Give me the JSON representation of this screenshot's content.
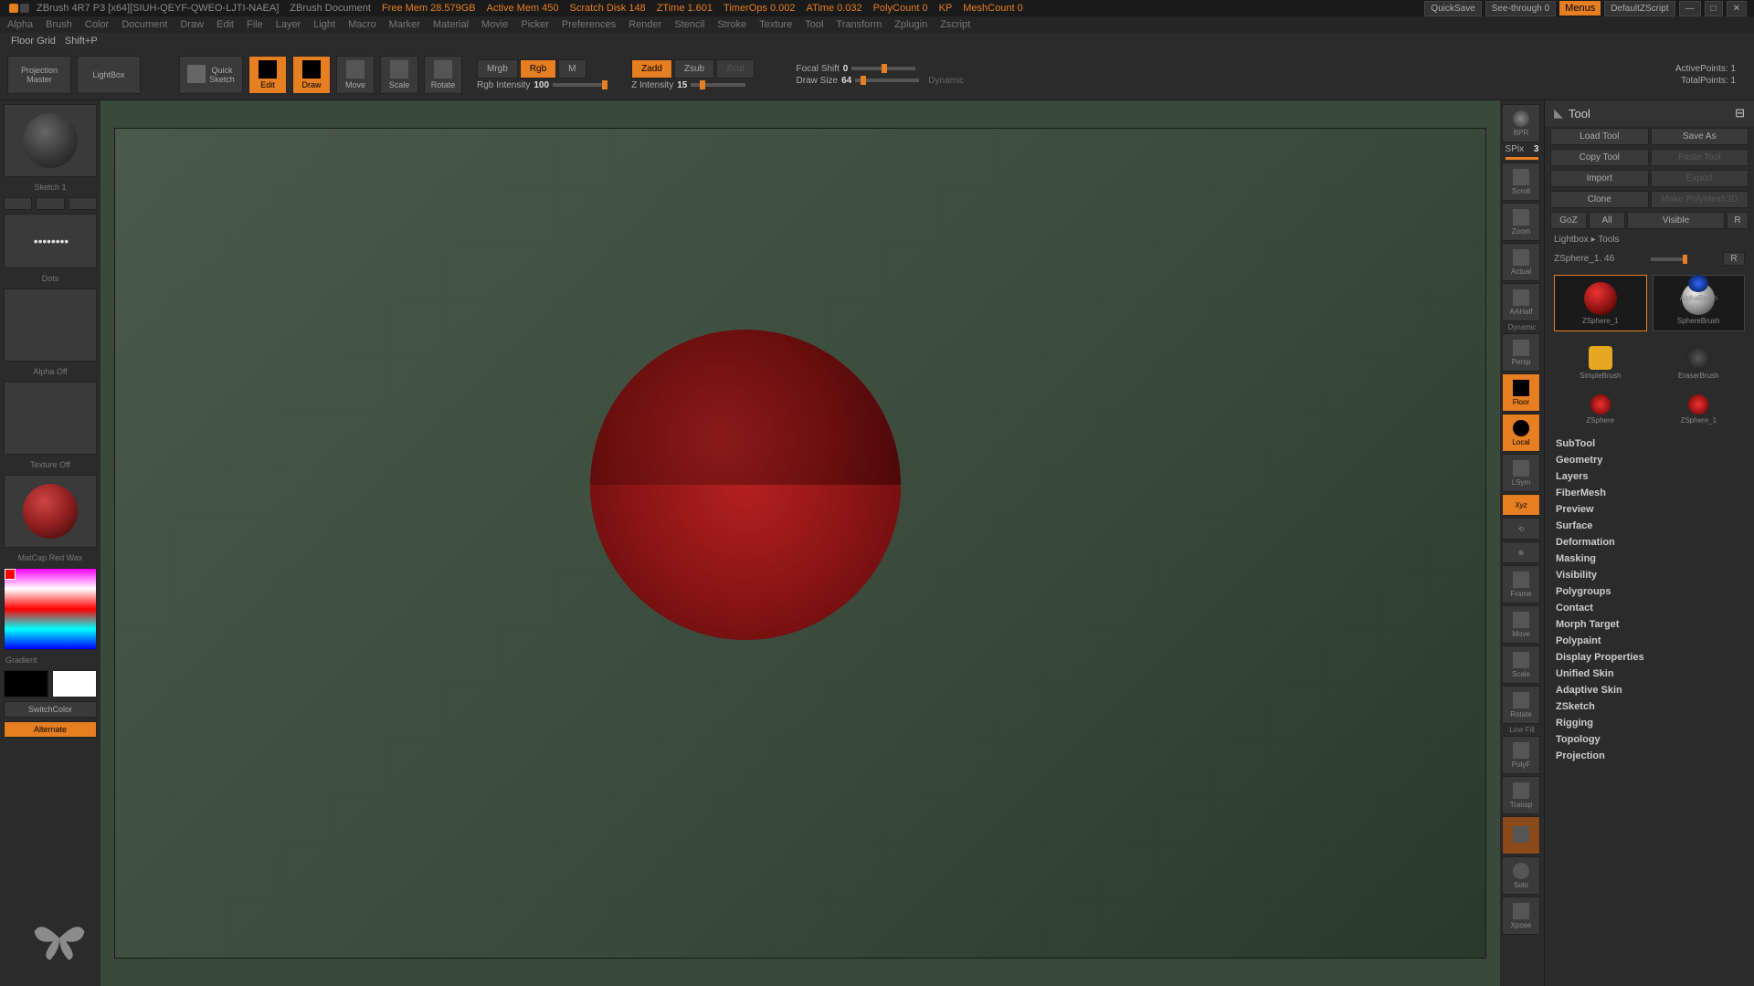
{
  "title": {
    "app": "ZBrush 4R7 P3 [x64][SIUH-QEYF-QWEO-LJTI-NAEA]",
    "doc": "ZBrush Document",
    "stats": [
      "Free Mem 28.579GB",
      "Active Mem 450",
      "Scratch Disk 148",
      "ZTime 1.601",
      "TimerOps 0.002",
      "ATime 0.032",
      "PolyCount 0",
      "KP",
      "MeshCount 0"
    ],
    "quicksave": "QuickSave",
    "seethrough": "See-through  0",
    "menus": "Menus",
    "script": "DefaultZScript"
  },
  "menu": [
    "Alpha",
    "Brush",
    "Color",
    "Document",
    "Draw",
    "Edit",
    "File",
    "Layer",
    "Light",
    "Macro",
    "Marker",
    "Material",
    "Movie",
    "Picker",
    "Preferences",
    "Render",
    "Stencil",
    "Stroke",
    "Texture",
    "Tool",
    "Transform",
    "Zplugin",
    "Zscript"
  ],
  "status": {
    "label": "Floor Grid",
    "shortcut": "Shift+P"
  },
  "toolbar": {
    "projection": "Projection\nMaster",
    "lightbox": "LightBox",
    "quicksketch": "Quick\nSketch",
    "edit": "Edit",
    "draw": "Draw",
    "move": "Move",
    "scale": "Scale",
    "rotate": "Rotate",
    "mrgb": "Mrgb",
    "rgb": "Rgb",
    "m": "M",
    "rgb_intensity_label": "Rgb Intensity",
    "rgb_intensity_val": "100",
    "zadd": "Zadd",
    "zsub": "Zsub",
    "zcut": "Zcut",
    "z_intensity_label": "Z Intensity",
    "z_intensity_val": "15",
    "focal_label": "Focal Shift",
    "focal_val": "0",
    "draw_size_label": "Draw Size",
    "draw_size_val": "64",
    "dynamic": "Dynamic",
    "active_pts": "ActivePoints: 1",
    "total_pts": "TotalPoints: 1"
  },
  "left": {
    "sketch": "Sketch 1",
    "dots": "Dots",
    "alpha": "Alpha Off",
    "texture": "Texture Off",
    "matcap": "MatCap Red Wax",
    "gradient": "Gradient",
    "switchcolor": "SwitchColor",
    "alternate": "Alternate"
  },
  "right_tools": {
    "spix_label": "SPix",
    "spix_val": "3",
    "items": [
      "BPR",
      "Scroll",
      "Zoom",
      "Actual",
      "AAHalf",
      "Persp",
      "Floor",
      "Local",
      "LSym",
      "",
      "",
      "Frame",
      "Move",
      "Scale",
      "Rotate",
      "PolyF",
      "Transp",
      "",
      "Solo",
      "Xpose"
    ],
    "active": [
      "Floor",
      "Local"
    ],
    "dynamic": "Dynamic",
    "linefill": "Line Fill",
    "xyz": "Xyz"
  },
  "right_panel": {
    "header": "Tool",
    "load": "Load Tool",
    "save": "Save As",
    "copy": "Copy Tool",
    "paste": "Paste Tool",
    "import": "Import",
    "export": "Export",
    "clone": "Clone",
    "polymesh": "Make PolyMesh3D",
    "goz": "GoZ",
    "all": "All",
    "visible": "Visible",
    "r": "R",
    "lightbox_tools": "Lightbox ▸ Tools",
    "tool_name": "ZSphere_1. 46",
    "thumbs": [
      "ZSphere_1",
      "SphereBrush",
      "AlphaBrush",
      "SimpleBrush",
      "EraserBrush",
      "ZSphere",
      "ZSphere_1"
    ],
    "sections": [
      "SubTool",
      "Geometry",
      "Layers",
      "FiberMesh",
      "Preview",
      "Surface",
      "Deformation",
      "Masking",
      "Visibility",
      "Polygroups",
      "Contact",
      "Morph Target",
      "Polypaint",
      "Display Properties",
      "Unified Skin",
      "Adaptive Skin",
      "ZSketch",
      "Rigging",
      "Topology",
      "Projection"
    ]
  }
}
